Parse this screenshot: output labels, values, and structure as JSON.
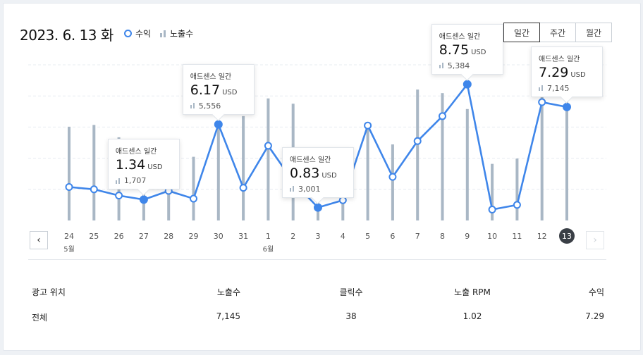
{
  "header": {
    "date_title": "2023. 6. 13 화",
    "legend_revenue": "수익",
    "legend_impressions": "노출수",
    "period_tabs": [
      "일간",
      "주간",
      "월간"
    ],
    "active_period": 0
  },
  "colors": {
    "line": "#3f86ea",
    "bar": "#a9b7c5",
    "grid": "#e7ecf1"
  },
  "chart_data": {
    "type": "line",
    "x": [
      "24",
      "25",
      "26",
      "27",
      "28",
      "29",
      "30",
      "31",
      "1",
      "2",
      "3",
      "4",
      "5",
      "6",
      "7",
      "8",
      "9",
      "10",
      "11",
      "12",
      "13"
    ],
    "month_labels": [
      {
        "index": 0,
        "label": "5월"
      },
      {
        "index": 8,
        "label": "6월"
      }
    ],
    "selected_index": 20,
    "series": [
      {
        "name": "수익",
        "kind": "line",
        "values": [
          2.15,
          2.0,
          1.6,
          1.34,
          1.9,
          1.4,
          6.17,
          2.1,
          4.8,
          2.5,
          0.83,
          1.3,
          6.1,
          2.8,
          5.1,
          6.7,
          8.75,
          0.7,
          1.0,
          7.6,
          7.29
        ]
      },
      {
        "name": "노출수",
        "kind": "bar",
        "values": [
          5300,
          5400,
          4700,
          1707,
          1600,
          3600,
          5556,
          5900,
          6900,
          6600,
          3001,
          3400,
          5200,
          4300,
          7400,
          7200,
          6300,
          3200,
          3500,
          8100,
          7145
        ]
      }
    ],
    "ylim_revenue": [
      0,
      10
    ],
    "ylim_impressions": [
      0,
      8800
    ],
    "grid": true
  },
  "tooltips": [
    {
      "index": 3,
      "label": "애드센스 일간",
      "value": "1.34",
      "unit": "USD",
      "impressions": "1,707"
    },
    {
      "index": 6,
      "label": "애드센스 일간",
      "value": "6.17",
      "unit": "USD",
      "impressions": "5,556"
    },
    {
      "index": 10,
      "label": "애드센스 일간",
      "value": "0.83",
      "unit": "USD",
      "impressions": "3,001"
    },
    {
      "index": 16,
      "label": "애드센스 일간",
      "value": "8.75",
      "unit": "USD",
      "impressions": "5,384"
    },
    {
      "index": 20,
      "label": "애드센스 일간",
      "value": "7.29",
      "unit": "USD",
      "impressions": "7,145"
    }
  ],
  "nav": {
    "prev": "‹",
    "next": "›"
  },
  "summary": {
    "headers": [
      "광고 위치",
      "노출수",
      "클릭수",
      "노출 RPM",
      "수익"
    ],
    "rows": [
      [
        "전체",
        "7,145",
        "38",
        "1.02",
        "7.29"
      ]
    ]
  }
}
